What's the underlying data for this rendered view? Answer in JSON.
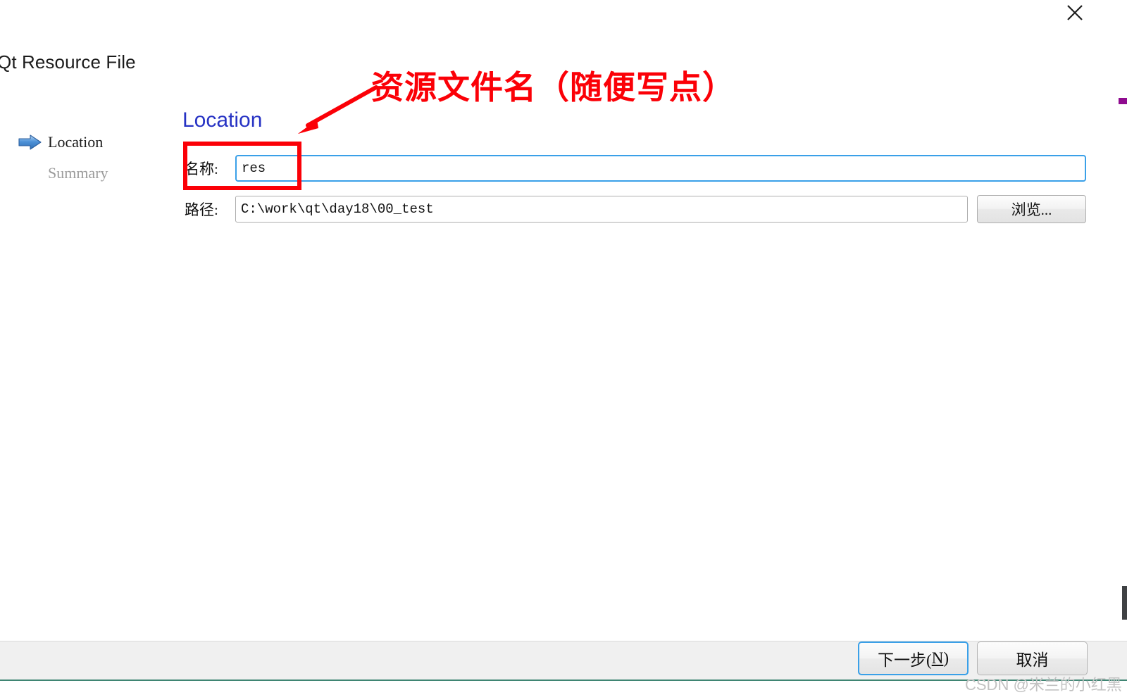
{
  "window": {
    "title": "Qt Resource File",
    "close_icon": "close-icon"
  },
  "steps": [
    {
      "label": "Location",
      "state": "current",
      "icon": "blue-arrow-icon"
    },
    {
      "label": "Summary",
      "state": "upcoming",
      "icon": "none"
    }
  ],
  "page": {
    "heading": "Location",
    "fields": [
      {
        "label": "名称:",
        "value": "res",
        "focused": true
      },
      {
        "label": "路径:",
        "value": "C:\\work\\qt\\day18\\00_test",
        "focused": false
      }
    ],
    "browse_button": "浏览..."
  },
  "footer": {
    "next_label_prefix": "下一步(",
    "next_mnemonic": "N",
    "next_label_suffix": ")",
    "cancel_label": "取消"
  },
  "annotations": {
    "callout_text": "资源文件名（随便写点）",
    "callout_color": "#fb0007",
    "highlight_box_target": "name-field-row"
  },
  "watermark": {
    "text": "CSDN @米兰的小红黑"
  },
  "colors": {
    "heading_blue": "#2733c4",
    "focus_blue": "#3aa0e8",
    "annotation_red": "#fb0007",
    "footer_bg": "#f0f0f0",
    "footer_accent": "#3f8573",
    "step_upcoming": "#9c9c9c"
  }
}
